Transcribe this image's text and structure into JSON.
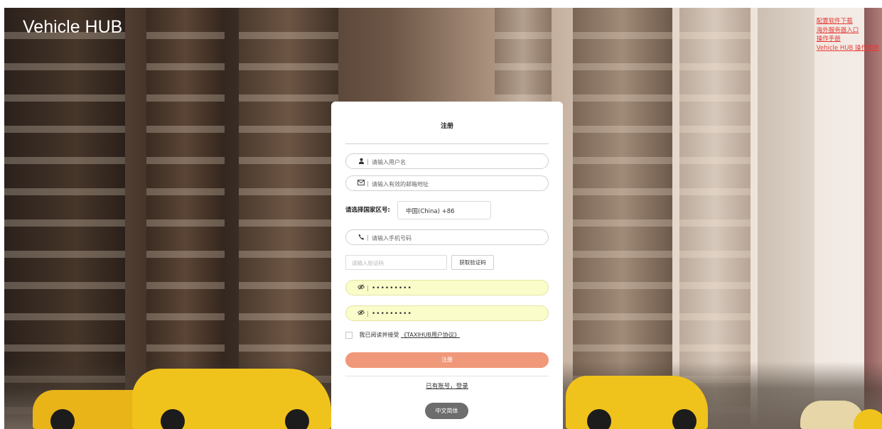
{
  "app": {
    "brand": "Vehicle HUB"
  },
  "top_links": [
    {
      "label": "配置软件下载"
    },
    {
      "label": "海外服务器入口"
    },
    {
      "label": "操作手册"
    },
    {
      "label": "Vehicle HUB 操作视频"
    }
  ],
  "form": {
    "title": "注册",
    "username_placeholder": "请输入用户名",
    "email_placeholder": "请输入有效的邮箱地址",
    "country_label": "请选择国家区号:",
    "country_value": "中国(China)  +86",
    "phone_placeholder": "请输入手机号码",
    "code_placeholder": "请输入验证码",
    "get_code_label": "获取验证码",
    "password_value": "•••••••••",
    "confirm_password_value": "•••••••••",
    "agree_text": "我已阅读并接受",
    "agree_link": "《TAXIHUB用户协议》",
    "submit_label": "注册",
    "login_link": "已有账号，登录",
    "language_label": "中文简体"
  },
  "colors": {
    "accent": "#f0987a",
    "link_red": "#e53935",
    "password_bg": "#fafcc9"
  },
  "icons": [
    "user-icon",
    "mail-icon",
    "phone-icon",
    "eye-off-icon",
    "chevron-down-icon"
  ]
}
